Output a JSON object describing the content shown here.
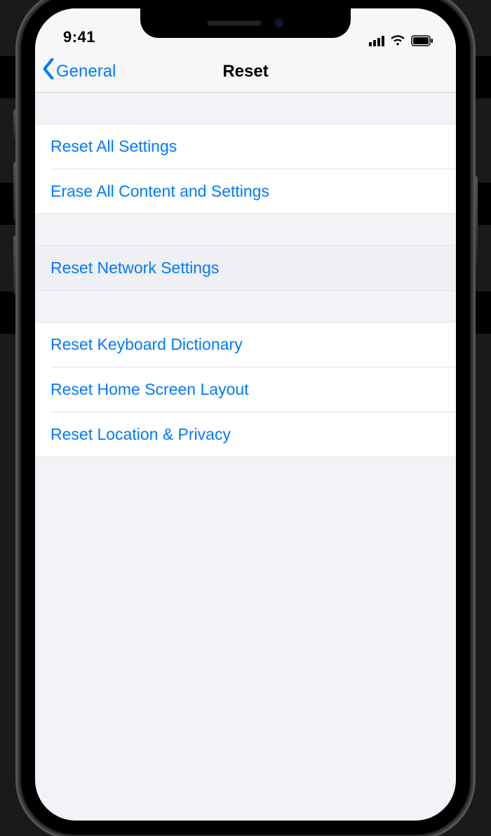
{
  "statusBar": {
    "time": "9:41"
  },
  "nav": {
    "backLabel": "General",
    "title": "Reset"
  },
  "sections": {
    "group1": {
      "row0": "Reset All Settings",
      "row1": "Erase All Content and Settings"
    },
    "group2": {
      "row0": "Reset Network Settings"
    },
    "group3": {
      "row0": "Reset Keyboard Dictionary",
      "row1": "Reset Home Screen Layout",
      "row2": "Reset Location & Privacy"
    }
  }
}
